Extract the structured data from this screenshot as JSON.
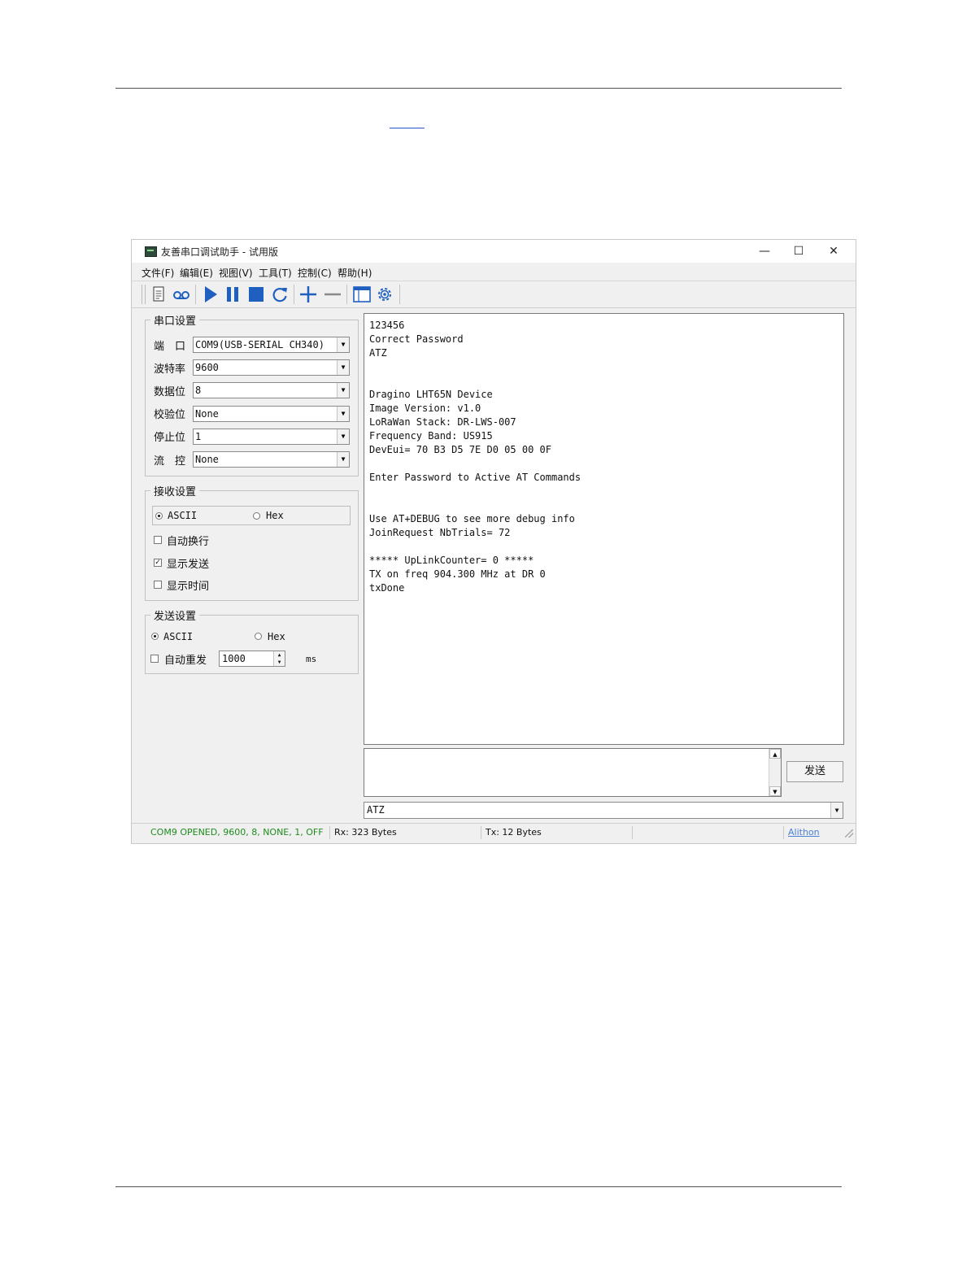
{
  "window": {
    "title": "友善串口调试助手 - 试用版",
    "minimize_glyph": "—",
    "maximize_glyph": "☐",
    "close_glyph": "✕"
  },
  "menu": [
    "文件(F)",
    "编辑(E)",
    "视图(V)",
    "工具(T)",
    "控制(C)",
    "帮助(H)"
  ],
  "toolbar": {
    "icons": [
      "new-document-icon",
      "record-icon",
      "play-icon",
      "pause-icon",
      "stop-icon",
      "refresh-icon",
      "add-icon",
      "remove-icon",
      "window-icon",
      "settings-icon"
    ],
    "accent": "#1f5fbf"
  },
  "serial_settings": {
    "legend": "串口设置",
    "port_label": "端　口",
    "port_value": "COM9(USB-SERIAL CH340)",
    "baud_label": "波特率",
    "baud_value": "9600",
    "databits_label": "数据位",
    "databits_value": "8",
    "parity_label": "校验位",
    "parity_value": "None",
    "stopbits_label": "停止位",
    "stopbits_value": "1",
    "flow_label": "流　控",
    "flow_value": "None"
  },
  "receive_settings": {
    "legend": "接收设置",
    "ascii_label": "ASCII",
    "hex_label": "Hex",
    "mode": "ASCII",
    "auto_newline_label": "自动换行",
    "auto_newline": false,
    "show_send_label": "显示发送",
    "show_send": true,
    "show_time_label": "显示时间",
    "show_time": false
  },
  "send_settings": {
    "legend": "发送设置",
    "ascii_label": "ASCII",
    "hex_label": "Hex",
    "mode": "ASCII",
    "auto_resend_label": "自动重发",
    "auto_resend": false,
    "interval_value": "1000",
    "interval_unit": "ms"
  },
  "receive_text": "123456\nCorrect Password\nATZ\n\n\nDragino LHT65N Device\nImage Version: v1.0\nLoRaWan Stack: DR-LWS-007\nFrequency Band: US915\nDevEui= 70 B3 D5 7E D0 05 00 0F\n\nEnter Password to Active AT Commands\n\n\nUse AT+DEBUG to see more debug info\nJoinRequest NbTrials= 72\n\n***** UpLinkCounter= 0 *****\nTX on freq 904.300 MHz at DR 0\ntxDone",
  "send": {
    "button_label": "发送",
    "history_value": "ATZ"
  },
  "status": {
    "connection": "COM9 OPENED, 9600, 8, NONE, 1, OFF",
    "connection_color": "#1e8c1e",
    "rx": "Rx: 323 Bytes",
    "tx": "Tx: 12 Bytes",
    "brand": "Alithon"
  }
}
